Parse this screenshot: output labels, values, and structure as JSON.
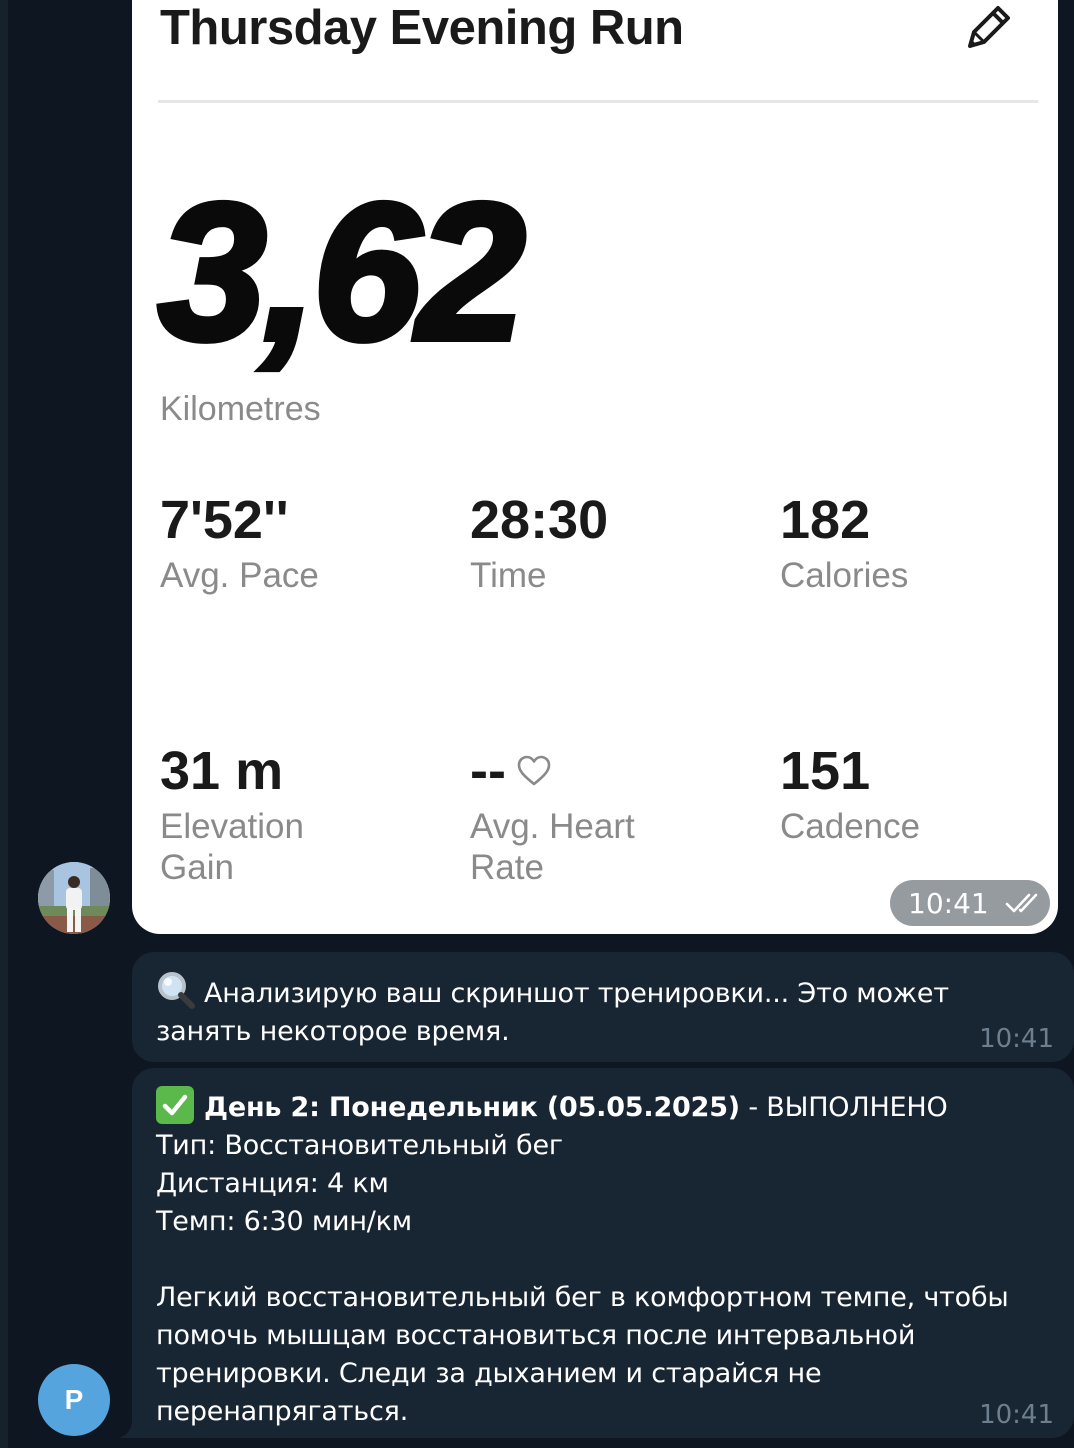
{
  "photo_message": {
    "title": "Thursday Evening Run",
    "distance_value": "3,62",
    "distance_unit": "Kilometres",
    "stats": [
      {
        "value": "7'52''",
        "label_line1": "Avg. Pace",
        "label_line2": ""
      },
      {
        "value": "28:30",
        "label_line1": "Time",
        "label_line2": ""
      },
      {
        "value": "182",
        "label_line1": "Calories",
        "label_line2": ""
      },
      {
        "value": "31 m",
        "label_line1": "Elevation",
        "label_line2": "Gain"
      },
      {
        "value": "--",
        "label_line1": "Avg. Heart",
        "label_line2": "Rate"
      },
      {
        "value": "151",
        "label_line1": "Cadence",
        "label_line2": ""
      }
    ],
    "time": "10:41",
    "icons": {
      "edit": "pencil-icon",
      "heart": "heart-outline-icon",
      "read": "double-check-icon"
    }
  },
  "avatar_bot": {
    "letter": "P",
    "color": "#55a4de"
  },
  "message_analyzing": {
    "text": "Анализирую ваш скриншот тренировки... Это может занять некоторое время.",
    "time": "10:41",
    "icon": "magnifier-emoji"
  },
  "message_plan": {
    "heading": "День 2: Понедельник (05.05.2025)",
    "status": " - ВЫПОЛНЕНО",
    "type_line": "Тип: Восстановительный бег",
    "distance_line": "Дистанция: 4 км",
    "pace_line": "Темп: 6:30 мин/км",
    "description": "Легкий восстановительный бег в комфортном темпе, чтобы помочь мышцам восстановиться после интервальной тренировки. Следи за дыханием и старайся не перенапрягаться.",
    "time": "10:41",
    "icon": "check-mark-emoji"
  },
  "colors": {
    "background": "#0e1621",
    "bubble": "#182533",
    "time_text": "#6d7f8f"
  }
}
